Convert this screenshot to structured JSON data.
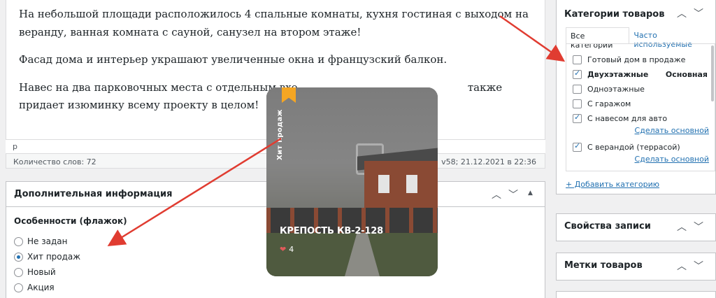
{
  "editor": {
    "paragraphs": [
      "На небольшой площади расположилось 4 спальные комнаты, кухня гостиная с выходом на веранду, ванная комната с сауной, санузел на втором этаже!",
      "Фасад дома и интерьер украшают увеличенные окна и французский балкон.",
      "Навес на два парковочных места с отдельным вхо                                                   также придает изюминку всему проекту в целом!"
    ],
    "path": "p",
    "word_count": "Количество слов: 72",
    "last_edit": "v58; 21.12.2021 в 22:36"
  },
  "meta_box": {
    "title": "Дополнительная информация",
    "field_label": "Особенности (флажок)",
    "options": [
      {
        "label": "Не задан",
        "checked": false
      },
      {
        "label": "Хит продаж",
        "checked": true
      },
      {
        "label": "Новый",
        "checked": false
      },
      {
        "label": "Акция",
        "checked": false
      }
    ]
  },
  "categories_box": {
    "title": "Категории товаров",
    "tab_all": "Все категории",
    "tab_popular": "Часто используемые",
    "items": [
      {
        "label": "Готовый дом в продаже",
        "checked": false
      },
      {
        "label": "Двухэтажные",
        "checked": true,
        "bold": true,
        "tag": "Основная"
      },
      {
        "label": "Одноэтажные",
        "checked": false
      },
      {
        "label": "С гаражом",
        "checked": false
      },
      {
        "label": "С навесом для авто",
        "checked": true,
        "link": "Сделать основной"
      },
      {
        "label": "С верандой (террасой)",
        "checked": true,
        "link": "Сделать основной"
      }
    ],
    "add_link": "+ Добавить категорию"
  },
  "properties_box": {
    "title": "Свойства записи"
  },
  "tags_box": {
    "title": "Метки товаров"
  },
  "card": {
    "ribbon": "Хит продаж",
    "title": "КРЕПОСТЬ КВ-2-128",
    "likes": "4"
  },
  "icons": {
    "chevron_up": "chevron-up-icon",
    "chevron_down": "chevron-down-icon",
    "toggle": "triangle-up-icon",
    "heart": "heart-icon",
    "arrow_color": "#e03c31",
    "ribbon_color": "#f5a623",
    "link_color": "#2271b1"
  }
}
